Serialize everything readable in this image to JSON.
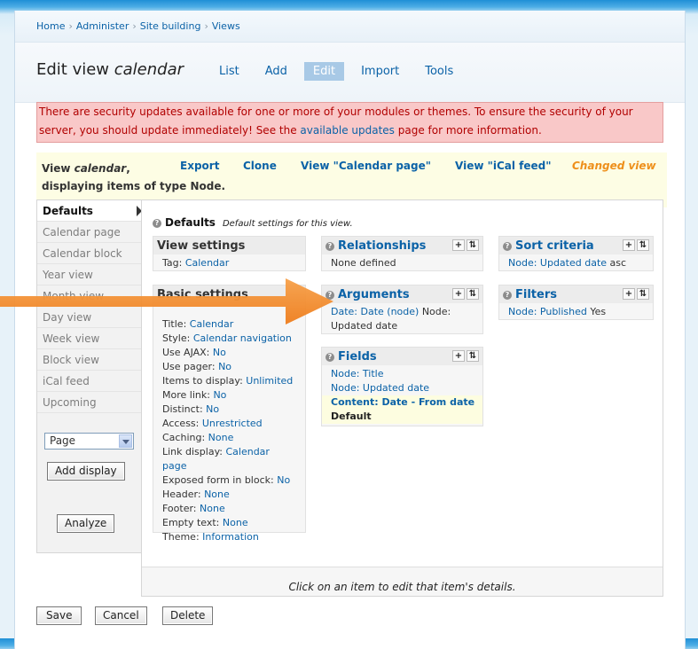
{
  "breadcrumb": [
    "Home",
    "Administer",
    "Site building",
    "Views"
  ],
  "title": {
    "prefix": "Edit view ",
    "name": "calendar"
  },
  "tabs": [
    "List",
    "Add",
    "Edit",
    "Import",
    "Tools"
  ],
  "alert": {
    "text1": "There are security updates available for one or more of your modules or themes. To ensure the security of your server, you should update immediately! See the ",
    "link": "available updates",
    "text2": " page for more information."
  },
  "viewbar": {
    "label": "View ",
    "name": "calendar",
    "comma": ",",
    "desc": "displaying items of type Node.",
    "links": [
      "Export",
      "Clone",
      "View \"Calendar page\"",
      "View \"iCal feed\""
    ],
    "changed": "Changed view"
  },
  "displays": [
    "Defaults",
    "Calendar page",
    "Calendar block",
    "Year view",
    "Month view",
    "Day view",
    "Week view",
    "Block view",
    "iCal feed",
    "Upcoming"
  ],
  "display_select": "Page",
  "buttons": {
    "add_display": "Add display",
    "analyze": "Analyze",
    "save": "Save",
    "cancel": "Cancel",
    "delete": "Delete"
  },
  "defaults": {
    "title": "Defaults",
    "desc": "Default settings for this view."
  },
  "view_settings": {
    "title": "View settings",
    "tag_label": "Tag: ",
    "tag_value": "Calendar"
  },
  "basic_settings": {
    "title": "Basic settings",
    "rows": [
      {
        "label": "Title: ",
        "value": "Calendar"
      },
      {
        "label": "Style: ",
        "value": "Calendar navigation"
      },
      {
        "label": "Use AJAX: ",
        "value": "No"
      },
      {
        "label": "Use pager: ",
        "value": "No"
      },
      {
        "label": "Items to display: ",
        "value": "Unlimited"
      },
      {
        "label": "More link: ",
        "value": "No"
      },
      {
        "label": "Distinct: ",
        "value": "No"
      },
      {
        "label": "Access: ",
        "value": "Unrestricted"
      },
      {
        "label": "Caching: ",
        "value": "None"
      },
      {
        "label": "Link display: ",
        "value": "Calendar page"
      },
      {
        "label": "Exposed form in block: ",
        "value": "No"
      },
      {
        "label": "Header: ",
        "value": "None"
      },
      {
        "label": "Footer: ",
        "value": "None"
      },
      {
        "label": "Empty text: ",
        "value": "None"
      },
      {
        "label": "Theme: ",
        "value": "Information"
      }
    ]
  },
  "relationships": {
    "title": "Relationships",
    "body": "None defined"
  },
  "arguments": {
    "title": "Arguments",
    "link": "Date: Date (node)",
    "rest": " Node: Updated date"
  },
  "fields": {
    "title": "Fields",
    "items": [
      "Node: Title",
      "Node: Updated date"
    ],
    "highlight": "Content: Date - From date",
    "default": "Default"
  },
  "sort_criteria": {
    "title": "Sort criteria",
    "link": "Node: Updated date",
    "rest": " asc"
  },
  "filters": {
    "title": "Filters",
    "link": "Node: Published",
    "rest": " Yes"
  },
  "footer_hint": "Click on an item to edit that item's details.",
  "icons": {
    "add": "+",
    "rearrange": "⇅",
    "help": "?"
  }
}
